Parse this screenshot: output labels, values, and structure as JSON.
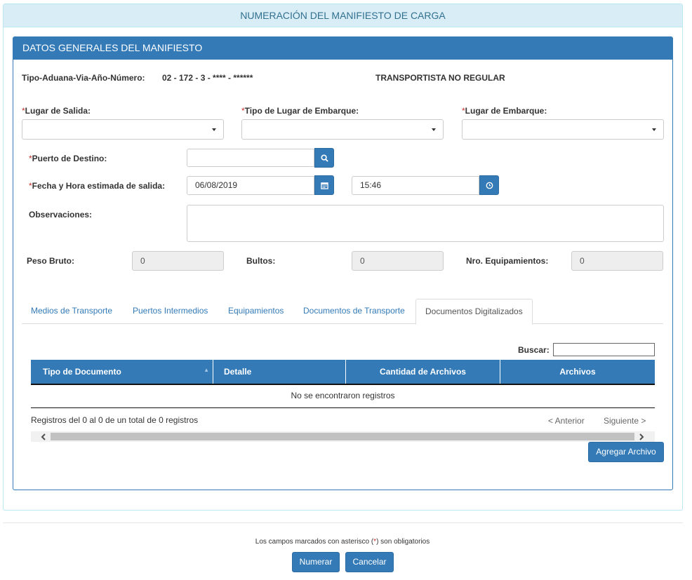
{
  "header": {
    "title": "NUMERACIÓN DEL MANIFIESTO DE CARGA"
  },
  "panel": {
    "title": "DATOS GENERALES DEL MANIFIESTO"
  },
  "manifest": {
    "id_label": "Tipo-Aduana-Via-Año-Número:",
    "id_value": "02 - 172 - 3 - **** - ******",
    "carrier_type": "TRANSPORTISTA NO REGULAR"
  },
  "required_mark": "*",
  "fields": {
    "lugar_salida": {
      "label": "Lugar de Salida:",
      "value": ""
    },
    "tipo_lugar_embarque": {
      "label": "Tipo de Lugar de Embarque:",
      "value": ""
    },
    "lugar_embarque": {
      "label": "Lugar de Embarque:",
      "value": ""
    },
    "puerto_destino": {
      "label": "Puerto de Destino:",
      "value": ""
    },
    "fecha_hora": {
      "label": "Fecha y Hora estimada de salida:",
      "date": "06/08/2019",
      "time": "15:46"
    },
    "observaciones": {
      "label": "Observaciones:",
      "value": ""
    },
    "peso_bruto": {
      "label": "Peso Bruto:",
      "value": "0"
    },
    "bultos": {
      "label": "Bultos:",
      "value": "0"
    },
    "nro_equipamientos": {
      "label": "Nro. Equipamientos:",
      "value": "0"
    }
  },
  "tabs": [
    {
      "label": "Medios de Transporte",
      "active": false
    },
    {
      "label": "Puertos Intermedios",
      "active": false
    },
    {
      "label": "Equipamientos",
      "active": false
    },
    {
      "label": "Documentos de Transporte",
      "active": false
    },
    {
      "label": "Documentos Digitalizados",
      "active": true
    }
  ],
  "table": {
    "search_label": "Buscar:",
    "search_value": "",
    "columns": [
      "Tipo de Documento",
      "Detalle",
      "Cantidad de Archivos",
      "Archivos"
    ],
    "empty_message": "No se encontraron registros",
    "info": "Registros del 0 al 0 de un total de 0 registros",
    "prev_label": "< Anterior",
    "next_label": "Siguiente >"
  },
  "buttons": {
    "agregar_archivo": "Agregar Archivo",
    "numerar": "Numerar",
    "cancelar": "Cancelar"
  },
  "footer": {
    "note_before": "Los campos marcados con asterisco (",
    "note_mark": "*",
    "note_after": ") son obligatorios"
  },
  "icons": {
    "search": "search-icon",
    "calendar": "calendar-icon",
    "clock": "clock-icon",
    "sort": "sort-icon",
    "scroll_left": "scroll-left-arrow-icon",
    "scroll_right": "scroll-right-arrow-icon"
  },
  "colors": {
    "primary": "#337ab7",
    "info_bg": "#d9edf7",
    "info_text": "#31708f",
    "required": "#c9302c"
  }
}
